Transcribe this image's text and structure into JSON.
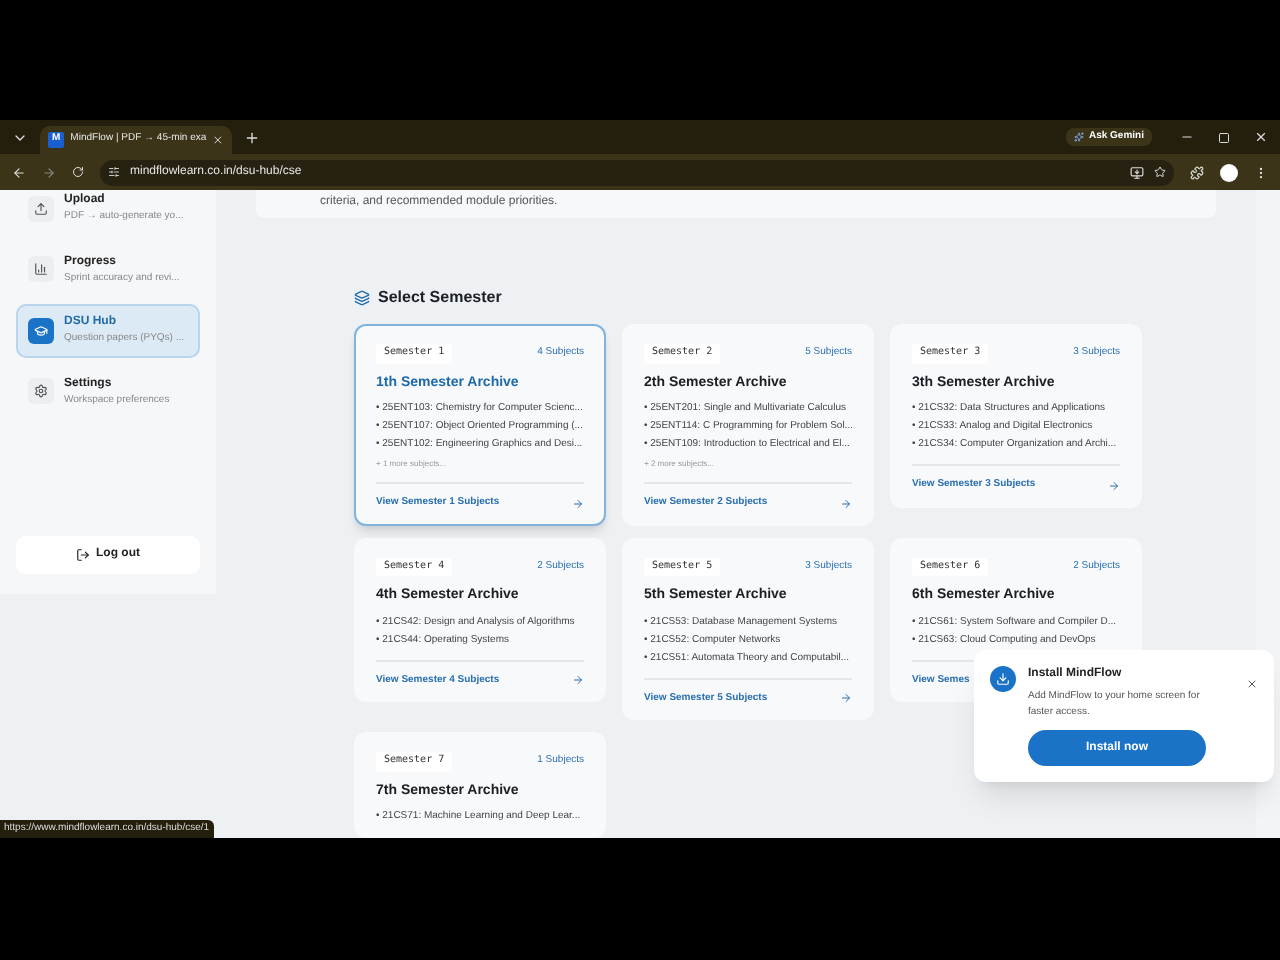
{
  "browser": {
    "tab_icon": "M",
    "tab_title": "MindFlow | PDF → 45-min exa",
    "gemini": "Ask Gemini",
    "url": "mindflowlearn.co.in/dsu-hub/cse"
  },
  "sidebar": {
    "items": [
      {
        "title": "Upload",
        "subtitle": "PDF → auto-generate yo...",
        "selected": false
      },
      {
        "title": "Progress",
        "subtitle": "Sprint accuracy and revi...",
        "selected": false
      },
      {
        "title": "DSU Hub",
        "subtitle": "Question papers (PYQs) ...",
        "selected": true
      },
      {
        "title": "Settings",
        "subtitle": "Workspace preferences",
        "selected": false
      }
    ],
    "logout": "Log out"
  },
  "intro": "criteria, and recommended module priorities.",
  "section_title": "Select Semester",
  "semesters": [
    {
      "badge": "Semester 1",
      "count": "4 Subjects",
      "title": "1th Semester Archive",
      "subjects": [
        "• 25ENT103: Chemistry for Computer Scienc...",
        "• 25ENT107: Object Oriented Programming (...",
        "• 25ENT102: Engineering Graphics and Desi..."
      ],
      "more": "+ 1 more subjects...",
      "link": "View Semester 1 Subjects",
      "selected": true,
      "arrow": true
    },
    {
      "badge": "Semester 2",
      "count": "5 Subjects",
      "title": "2th Semester Archive",
      "subjects": [
        "• 25ENT201: Single and Multivariate Calculus",
        "• 25ENT114: C Programming for Problem Sol...",
        "• 25ENT109: Introduction to Electrical and El..."
      ],
      "more": "+ 2 more subjects...",
      "link": "View Semester 2 Subjects",
      "selected": false,
      "arrow": true
    },
    {
      "badge": "Semester 3",
      "count": "3 Subjects",
      "title": "3th Semester Archive",
      "subjects": [
        "• 21CS32: Data Structures and Applications",
        "• 21CS33: Analog and Digital Electronics",
        "• 21CS34: Computer Organization and Archi..."
      ],
      "link": "View Semester 3 Subjects",
      "selected": false,
      "arrow": true
    },
    {
      "badge": "Semester 4",
      "count": "2 Subjects",
      "title": "4th Semester Archive",
      "subjects": [
        "• 21CS42: Design and Analysis of Algorithms",
        "• 21CS44: Operating Systems"
      ],
      "link": "View Semester 4 Subjects",
      "selected": false,
      "arrow": true
    },
    {
      "badge": "Semester 5",
      "count": "3 Subjects",
      "title": "5th Semester Archive",
      "subjects": [
        "• 21CS53: Database Management Systems",
        "• 21CS52: Computer Networks",
        "• 21CS51: Automata Theory and Computabil..."
      ],
      "link": "View Semester 5 Subjects",
      "selected": false,
      "arrow": true
    },
    {
      "badge": "Semester 6",
      "count": "2 Subjects",
      "title": "6th Semester Archive",
      "subjects": [
        "• 21CS61: System Software and Compiler D...",
        "• 21CS63: Cloud Computing and DevOps"
      ],
      "link": "View Semes",
      "selected": false,
      "arrow": false
    },
    {
      "badge": "Semester 7",
      "count": "1 Subjects",
      "title": "7th Semester Archive",
      "subjects": [
        "• 21CS71: Machine Learning and Deep Lear..."
      ],
      "selected": false,
      "arrow": false
    }
  ],
  "install": {
    "title": "Install MindFlow",
    "text": "Add MindFlow to your home screen for faster access.",
    "button": "Install now"
  },
  "status_url": "https://www.mindflowlearn.co.in/dsu-hub/cse/1"
}
